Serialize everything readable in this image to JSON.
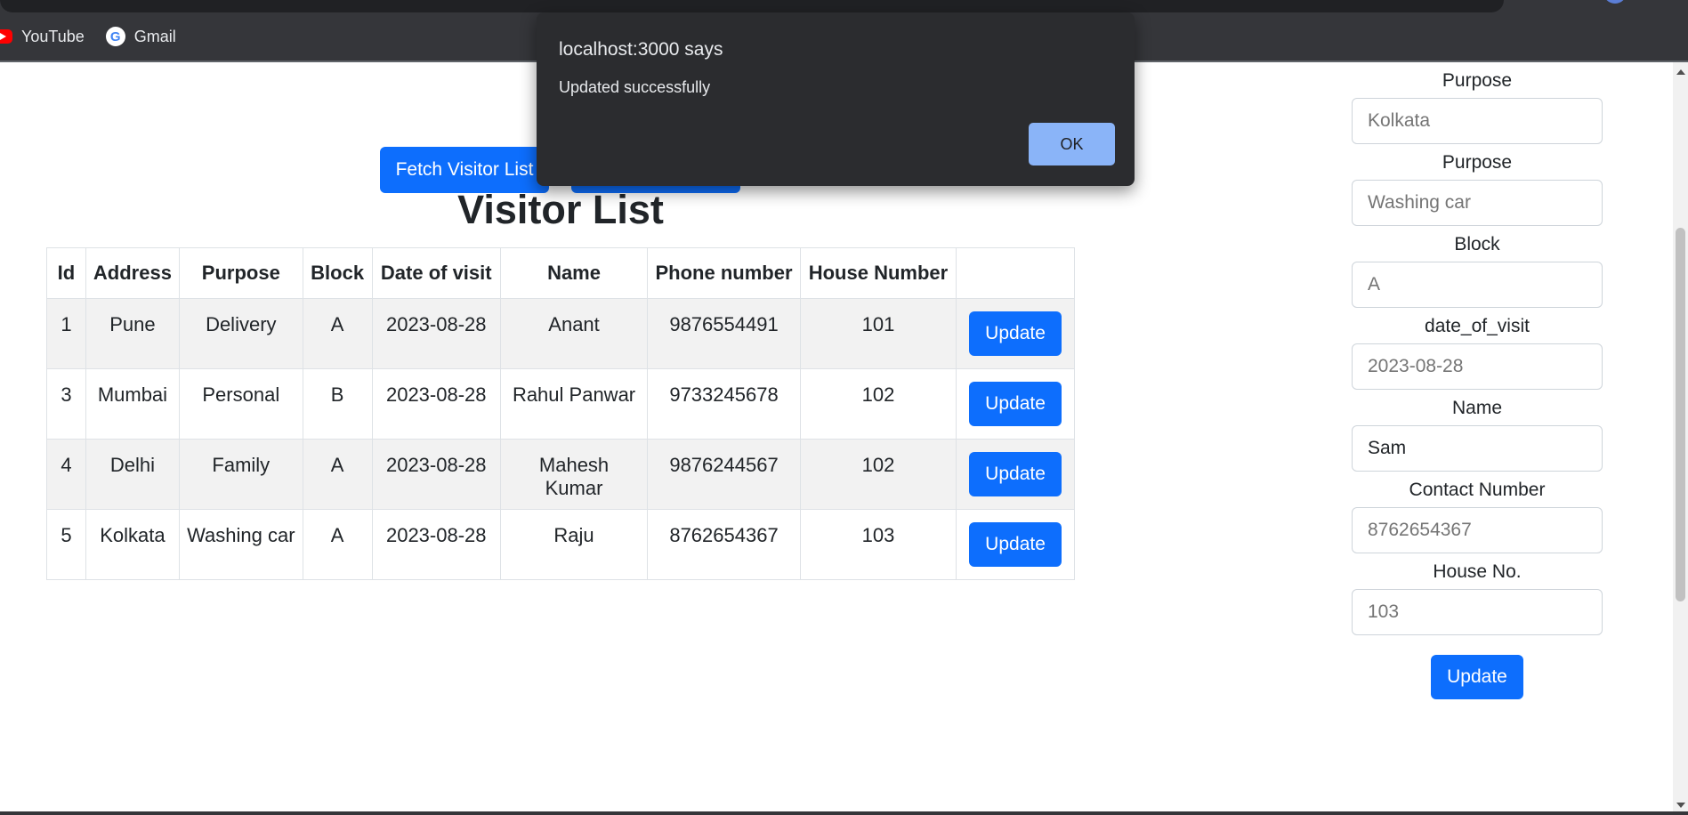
{
  "bookmarks": [
    {
      "label": "YouTube",
      "icon": "youtube-icon"
    },
    {
      "label": "Gmail",
      "icon": "google-icon"
    }
  ],
  "toolbar": {
    "fetch_label": "Fetch Visitor List",
    "second_label": ""
  },
  "page_title": "Visitor List",
  "table": {
    "headers": [
      "Id",
      "Address",
      "Purpose",
      "Block",
      "Date of visit",
      "Name",
      "Phone number",
      "House Number",
      ""
    ],
    "rows": [
      {
        "id": "1",
        "address": "Pune",
        "purpose": "Delivery",
        "block": "A",
        "date": "2023-08-28",
        "name": "Anant",
        "phone": "9876554491",
        "house": "101",
        "action": "Update"
      },
      {
        "id": "3",
        "address": "Mumbai",
        "purpose": "Personal",
        "block": "B",
        "date": "2023-08-28",
        "name": "Rahul Panwar",
        "phone": "9733245678",
        "house": "102",
        "action": "Update"
      },
      {
        "id": "4",
        "address": "Delhi",
        "purpose": "Family",
        "block": "A",
        "date": "2023-08-28",
        "name": "Mahesh Kumar",
        "phone": "9876244567",
        "house": "102",
        "action": "Update"
      },
      {
        "id": "5",
        "address": "Kolkata",
        "purpose": "Washing car",
        "block": "A",
        "date": "2023-08-28",
        "name": "Raju",
        "phone": "8762654367",
        "house": "103",
        "action": "Update"
      }
    ]
  },
  "form": {
    "fields": [
      {
        "label": "Purpose",
        "placeholder": "Kolkata",
        "value": ""
      },
      {
        "label": "Purpose",
        "placeholder": "Washing car",
        "value": ""
      },
      {
        "label": "Block",
        "placeholder": "A",
        "value": ""
      },
      {
        "label": "date_of_visit",
        "placeholder": "2023-08-28",
        "value": ""
      },
      {
        "label": "Name",
        "placeholder": "",
        "value": "Sam"
      },
      {
        "label": "Contact Number",
        "placeholder": "8762654367",
        "value": ""
      },
      {
        "label": "House No.",
        "placeholder": "103",
        "value": ""
      }
    ],
    "submit_label": "Update"
  },
  "dialog": {
    "title": "localhost:3000 says",
    "message": "Updated successfully",
    "ok_label": "OK"
  },
  "colors": {
    "primary": "#0d6efd",
    "dialog_bg": "#2b2c2f",
    "dialog_button": "#8ab4f8"
  }
}
